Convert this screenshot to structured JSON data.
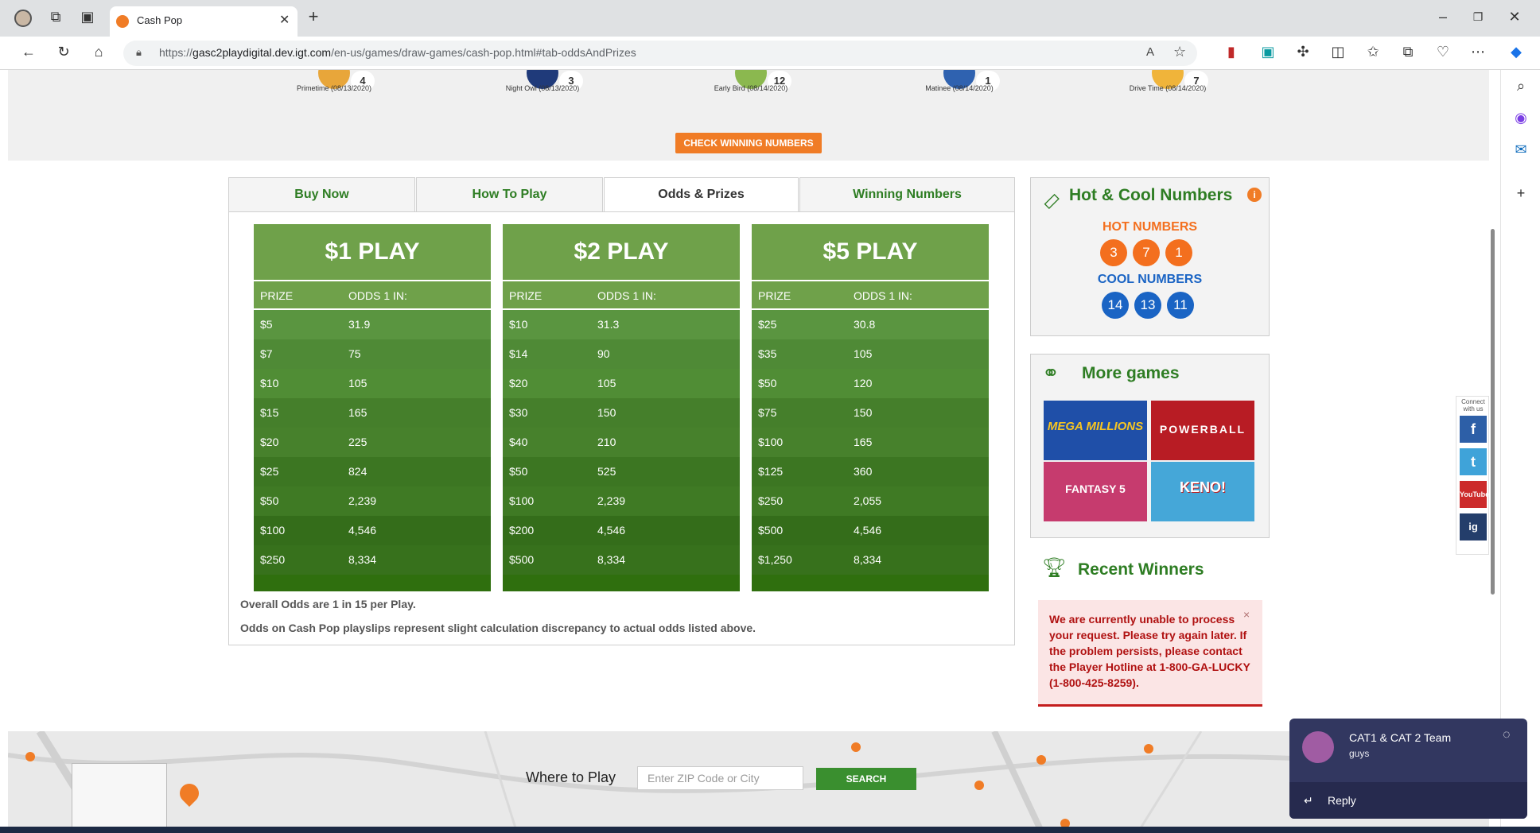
{
  "browser": {
    "tab_title": "Cash Pop",
    "url_prefix": "https://",
    "url_host": "gasc2playdigital.dev.igt.com",
    "url_path": "/en-us/games/draw-games/cash-pop.html#tab-oddsAndPrizes"
  },
  "draws": [
    {
      "label": "Primetime (08/13/2020)",
      "number": "4",
      "color": "#e8a63a"
    },
    {
      "label": "Night Owl (08/13/2020)",
      "number": "3",
      "color": "#1f3a7a"
    },
    {
      "label": "Early Bird (08/14/2020)",
      "number": "12",
      "color": "#8bb84f"
    },
    {
      "label": "Matinee (08/14/2020)",
      "number": "1",
      "color": "#2f62b0"
    },
    {
      "label": "Drive Time (08/14/2020)",
      "number": "7",
      "color": "#f0b43a"
    }
  ],
  "check_button": "CHECK WINNING NUMBERS",
  "tabs": [
    "Buy Now",
    "How To Play",
    "Odds & Prizes",
    "Winning Numbers"
  ],
  "cards": [
    {
      "title": "$1 PLAY",
      "col_prize": "PRIZE",
      "col_odds": "ODDS 1 IN:",
      "rows": [
        [
          "$5",
          "31.9"
        ],
        [
          "$7",
          "75"
        ],
        [
          "$10",
          "105"
        ],
        [
          "$15",
          "165"
        ],
        [
          "$20",
          "225"
        ],
        [
          "$25",
          "824"
        ],
        [
          "$50",
          "2,239"
        ],
        [
          "$100",
          "4,546"
        ],
        [
          "$250",
          "8,334"
        ]
      ]
    },
    {
      "title": "$2 PLAY",
      "col_prize": "PRIZE",
      "col_odds": "ODDS 1 IN:",
      "rows": [
        [
          "$10",
          "31.3"
        ],
        [
          "$14",
          "90"
        ],
        [
          "$20",
          "105"
        ],
        [
          "$30",
          "150"
        ],
        [
          "$40",
          "210"
        ],
        [
          "$50",
          "525"
        ],
        [
          "$100",
          "2,239"
        ],
        [
          "$200",
          "4,546"
        ],
        [
          "$500",
          "8,334"
        ]
      ]
    },
    {
      "title": "$5 PLAY",
      "col_prize": "PRIZE",
      "col_odds": "ODDS 1 IN:",
      "rows": [
        [
          "$25",
          "30.8"
        ],
        [
          "$35",
          "105"
        ],
        [
          "$50",
          "120"
        ],
        [
          "$75",
          "150"
        ],
        [
          "$100",
          "165"
        ],
        [
          "$125",
          "360"
        ],
        [
          "$250",
          "2,055"
        ],
        [
          "$500",
          "4,546"
        ],
        [
          "$1,250",
          "8,334"
        ]
      ]
    }
  ],
  "notes": {
    "overall": "Overall Odds are 1 in 15 per Play.",
    "discrepancy": "Odds on Cash Pop playslips represent slight calculation discrepancy to actual odds listed above."
  },
  "hot_cool": {
    "title": "Hot & Cool Numbers",
    "hot_label": "HOT NUMBERS",
    "hot": [
      "3",
      "7",
      "1"
    ],
    "cool_label": "COOL NUMBERS",
    "cool": [
      "14",
      "13",
      "11"
    ]
  },
  "more_games": {
    "title": "More games",
    "games": [
      "MEGA MILLIONS",
      "POWERBALL",
      "FANTASY 5",
      "KENO!"
    ]
  },
  "recent_winners": {
    "title": "Recent Winners",
    "error": "We are currently unable to process your request. Please try again later. If the problem persists, please contact the Player Hotline at 1-800-GA-LUCKY (1-800-425-8259)."
  },
  "social": {
    "label": "Connect with us",
    "buttons": [
      "f",
      "t",
      "YouTube",
      "ig"
    ]
  },
  "where_to_play": {
    "title": "Where to Play",
    "placeholder": "Enter ZIP Code or City",
    "button": "SEARCH"
  },
  "toast": {
    "title": "CAT1 & CAT 2 Team",
    "message": "guys",
    "reply": "Reply"
  }
}
